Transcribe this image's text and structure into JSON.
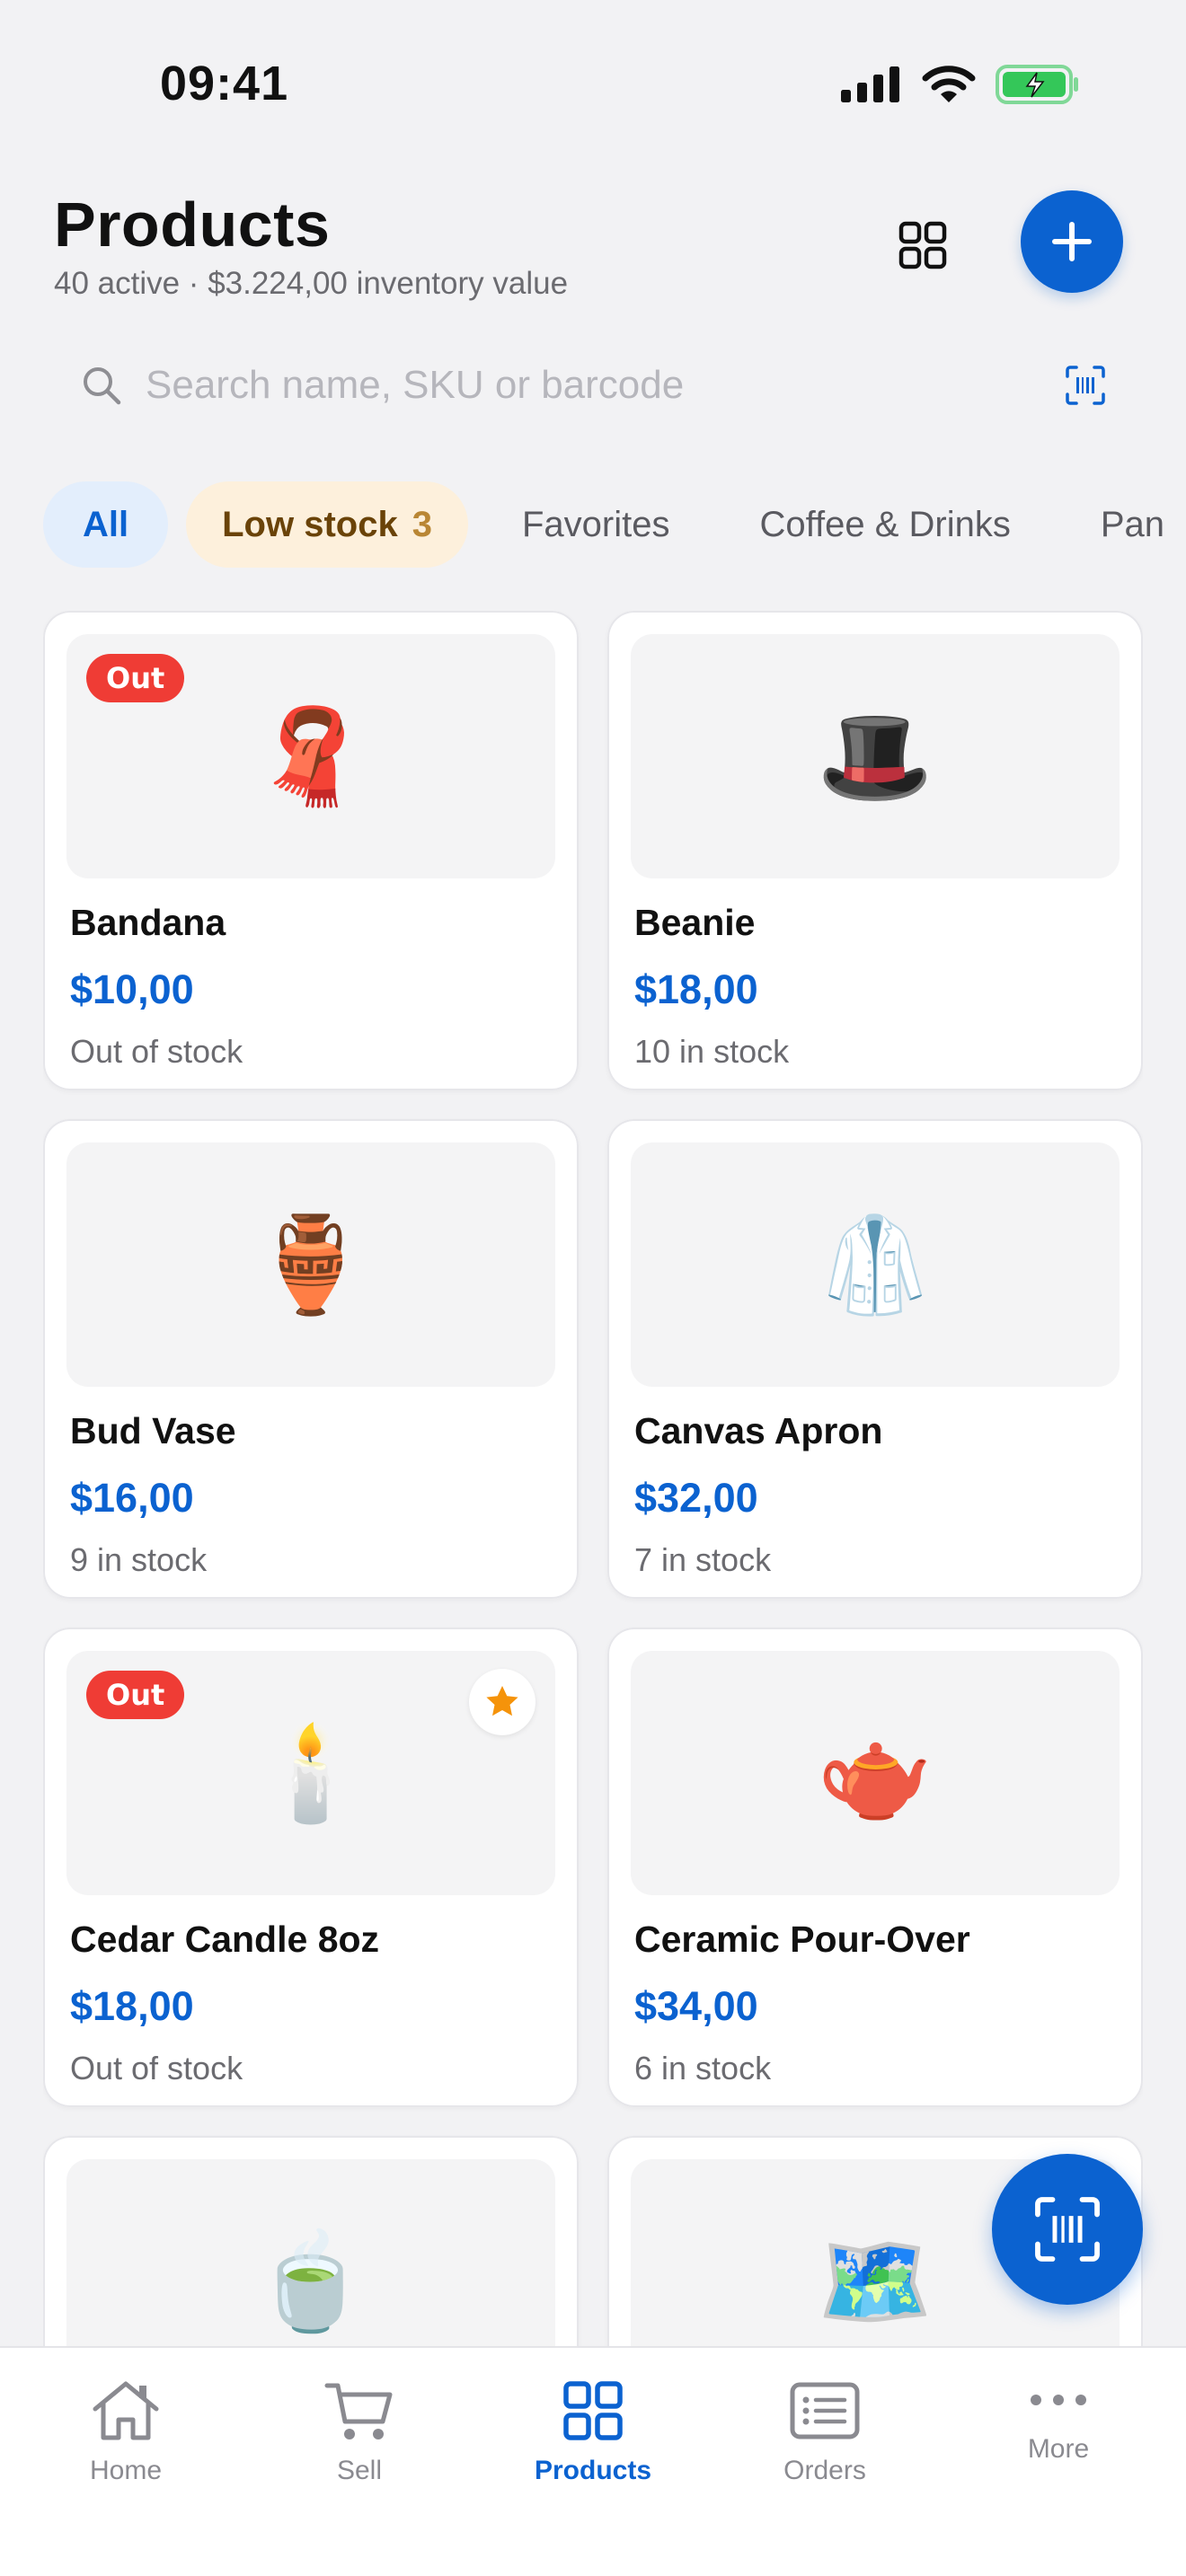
{
  "status_bar": {
    "time": "09:41"
  },
  "header": {
    "title": "Products",
    "subtitle": "40 active · $3.224,00 inventory value"
  },
  "search": {
    "placeholder": "Search name, SKU or barcode",
    "value": ""
  },
  "filters": [
    {
      "label": "All",
      "selected": true
    },
    {
      "label": "Low stock",
      "count": "3"
    },
    {
      "label": "Favorites"
    },
    {
      "label": "Coffee & Drinks"
    },
    {
      "label": "Pan"
    }
  ],
  "products": [
    {
      "name": "Bandana",
      "price": "$10,00",
      "stock": "Out of stock",
      "badge": "Out",
      "emoji": "🧣",
      "favorite": false
    },
    {
      "name": "Beanie",
      "price": "$18,00",
      "stock": "10 in stock",
      "badge": "",
      "emoji": "🎩",
      "favorite": false
    },
    {
      "name": "Bud Vase",
      "price": "$16,00",
      "stock": "9 in stock",
      "badge": "",
      "emoji": "🏺",
      "favorite": false
    },
    {
      "name": "Canvas Apron",
      "price": "$32,00",
      "stock": "7 in stock",
      "badge": "",
      "emoji": "🥼",
      "favorite": false
    },
    {
      "name": "Cedar Candle 8oz",
      "price": "$18,00",
      "stock": "Out of stock",
      "badge": "Out",
      "emoji": "🕯️",
      "favorite": true
    },
    {
      "name": "Ceramic Pour-Over",
      "price": "$34,00",
      "stock": "6 in stock",
      "badge": "",
      "emoji": "🫖",
      "favorite": false
    },
    {
      "emoji": "🍵"
    },
    {
      "emoji": "🗺️"
    }
  ],
  "tab_bar": [
    {
      "label": "Home",
      "icon": "home-icon"
    },
    {
      "label": "Sell",
      "icon": "cart-icon"
    },
    {
      "label": "Products",
      "icon": "grid-icon",
      "active": true
    },
    {
      "label": "Orders",
      "icon": "orders-icon"
    },
    {
      "label": "More",
      "icon": "more-icon"
    }
  ],
  "colors": {
    "accent": "#0b62d0",
    "out_badge": "#ef3c35",
    "low_stock_chip": "#fdf0dc",
    "favorite_star": "#f5930a"
  }
}
